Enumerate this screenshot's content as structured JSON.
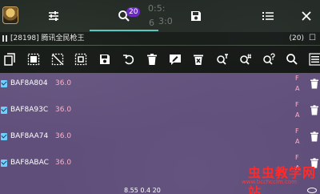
{
  "topbar": {
    "tabs": [
      {
        "name": "settings",
        "icon": "sliders-icon"
      },
      {
        "name": "search",
        "icon": "search-icon"
      },
      {
        "name": "saved",
        "icon": "save-icon"
      },
      {
        "name": "list",
        "icon": "list-icon"
      },
      {
        "name": "close",
        "icon": "close-icon"
      }
    ],
    "search_badge": "20",
    "ghost_texts": [
      "0:5:",
      "3:0",
      "6"
    ]
  },
  "infobar": {
    "process": "[28198] 腾讯全民枪王",
    "count": "(20)",
    "close": "☐"
  },
  "actions": [
    {
      "name": "copy",
      "icon": "copy-icon"
    },
    {
      "name": "select-all",
      "icon": "select-all-icon"
    },
    {
      "name": "deselect",
      "icon": "deselect-icon"
    },
    {
      "name": "invert-selection",
      "icon": "invert-selection-icon"
    },
    {
      "name": "save",
      "icon": "save-icon"
    },
    {
      "name": "undo",
      "icon": "undo-icon"
    },
    {
      "name": "delete",
      "icon": "trash-icon"
    },
    {
      "name": "edit",
      "icon": "edit-icon"
    },
    {
      "name": "delete-marked",
      "icon": "delete-marked-icon"
    },
    {
      "name": "search-text",
      "icon": "search-text-icon"
    },
    {
      "name": "search-number",
      "icon": "search-number-icon"
    },
    {
      "name": "search-question",
      "icon": "search-question-icon"
    },
    {
      "name": "search",
      "icon": "search-icon"
    },
    {
      "name": "menu",
      "icon": "menu-icon"
    }
  ],
  "results": [
    {
      "address": "BAF8A804",
      "value": "36.0",
      "flag1": "F",
      "flag2": "A"
    },
    {
      "address": "BAF8A93C",
      "value": "36.0",
      "flag1": "F",
      "flag2": "A"
    },
    {
      "address": "BAF8AA74",
      "value": "36.0",
      "flag1": "F",
      "flag2": "A"
    },
    {
      "address": "BAF8ABAC",
      "value": "36.0",
      "flag1": "F",
      "flag2": "A"
    }
  ],
  "footer": {
    "coordinate": "8.55 0.4 20"
  },
  "watermark": {
    "text": "虫虫教学网站",
    "url": "www.bcchcclm.com"
  },
  "colors": {
    "accent": "#57c7c0",
    "badge": "#6a2bc0",
    "list_bg": "#6c568c",
    "value": "#ffb1c8"
  }
}
